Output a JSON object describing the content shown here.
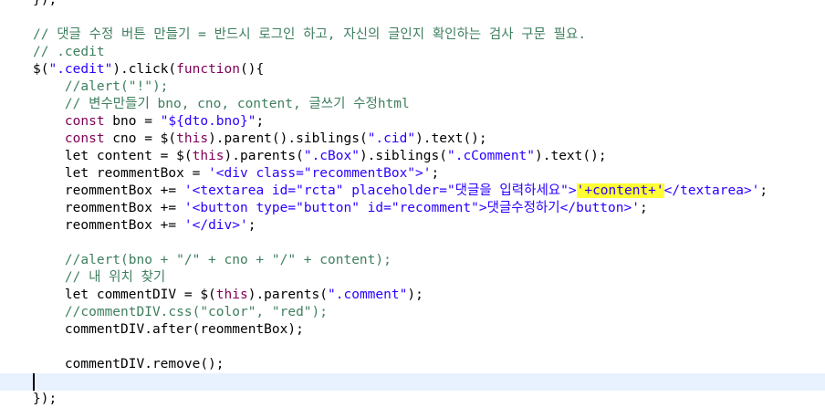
{
  "editor": {
    "colors": {
      "code": "#000000",
      "comment": "#3f7f5f",
      "string": "#2a00ff",
      "keyword": "#7f0055",
      "highlight": "#ffff33",
      "current_line": "#e8f2fe"
    },
    "lines": [
      [
        {
          "t": "code",
          "v": "});"
        }
      ],
      [],
      [
        {
          "t": "cmt",
          "v": "// 댓글 수정 버튼 만들기 = 반드시 로그인 하고, 자신의 글인지 확인하는 검사 구문 필요."
        }
      ],
      [
        {
          "t": "cmt",
          "v": "// .cedit"
        }
      ],
      [
        {
          "t": "code",
          "v": "$("
        },
        {
          "t": "str",
          "v": "\".cedit\""
        },
        {
          "t": "code",
          "v": ").click("
        },
        {
          "t": "kw",
          "v": "function"
        },
        {
          "t": "code",
          "v": "(){"
        }
      ],
      [
        {
          "t": "cmt",
          "v": "    //alert(\"!\");"
        }
      ],
      [
        {
          "t": "cmt",
          "v": "    // 변수만들기 bno, cno, content, 글쓰기 수정html"
        }
      ],
      [
        {
          "t": "kw",
          "v": "    const"
        },
        {
          "t": "code",
          "v": " bno = "
        },
        {
          "t": "str",
          "v": "\"${dto.bno}\""
        },
        {
          "t": "code",
          "v": ";"
        }
      ],
      [
        {
          "t": "kw",
          "v": "    const"
        },
        {
          "t": "code",
          "v": " cno = $("
        },
        {
          "t": "kw",
          "v": "this"
        },
        {
          "t": "code",
          "v": ").parent().siblings("
        },
        {
          "t": "str",
          "v": "\".cid\""
        },
        {
          "t": "code",
          "v": ").text();"
        }
      ],
      [
        {
          "t": "code",
          "v": "    let content = $("
        },
        {
          "t": "kw",
          "v": "this"
        },
        {
          "t": "code",
          "v": ").parents("
        },
        {
          "t": "str",
          "v": "\".cBox\""
        },
        {
          "t": "code",
          "v": ").siblings("
        },
        {
          "t": "str",
          "v": "\".cComment\""
        },
        {
          "t": "code",
          "v": ").text();"
        }
      ],
      [
        {
          "t": "code",
          "v": "    let reommentBox = "
        },
        {
          "t": "str",
          "v": "'<div class=\"recommentBox\">'"
        },
        {
          "t": "code",
          "v": ";"
        }
      ],
      [
        {
          "t": "code",
          "v": "    reommentBox += "
        },
        {
          "t": "str",
          "v": "'<textarea id=\"rcta\" placeholder=\"댓글을 입력하세요\">"
        },
        {
          "t": "hl",
          "v": "'+content+'"
        },
        {
          "t": "str",
          "v": "</textarea>'"
        },
        {
          "t": "code",
          "v": ";"
        }
      ],
      [
        {
          "t": "code",
          "v": "    reommentBox += "
        },
        {
          "t": "str",
          "v": "'<button type=\"button\" id=\"recomment\">댓글수정하기</button>'"
        },
        {
          "t": "code",
          "v": ";"
        }
      ],
      [
        {
          "t": "code",
          "v": "    reommentBox += "
        },
        {
          "t": "str",
          "v": "'</div>'"
        },
        {
          "t": "code",
          "v": ";"
        }
      ],
      [],
      [
        {
          "t": "cmt",
          "v": "    //alert(bno + \"/\" + cno + \"/\" + content);"
        }
      ],
      [
        {
          "t": "cmt",
          "v": "    // 내 위치 찾기"
        }
      ],
      [
        {
          "t": "code",
          "v": "    let commentDIV = $("
        },
        {
          "t": "kw",
          "v": "this"
        },
        {
          "t": "code",
          "v": ").parents("
        },
        {
          "t": "str",
          "v": "\".comment\""
        },
        {
          "t": "code",
          "v": ");"
        }
      ],
      [
        {
          "t": "cmt",
          "v": "    //commentDIV.css(\"color\", \"red\");"
        }
      ],
      [
        {
          "t": "code",
          "v": "    commentDIV.after(reommentBox);"
        }
      ],
      [],
      [
        {
          "t": "code",
          "v": "    commentDIV.remove();"
        }
      ],
      [],
      [
        {
          "t": "code",
          "v": "});"
        }
      ]
    ],
    "current_line_index": 22
  }
}
